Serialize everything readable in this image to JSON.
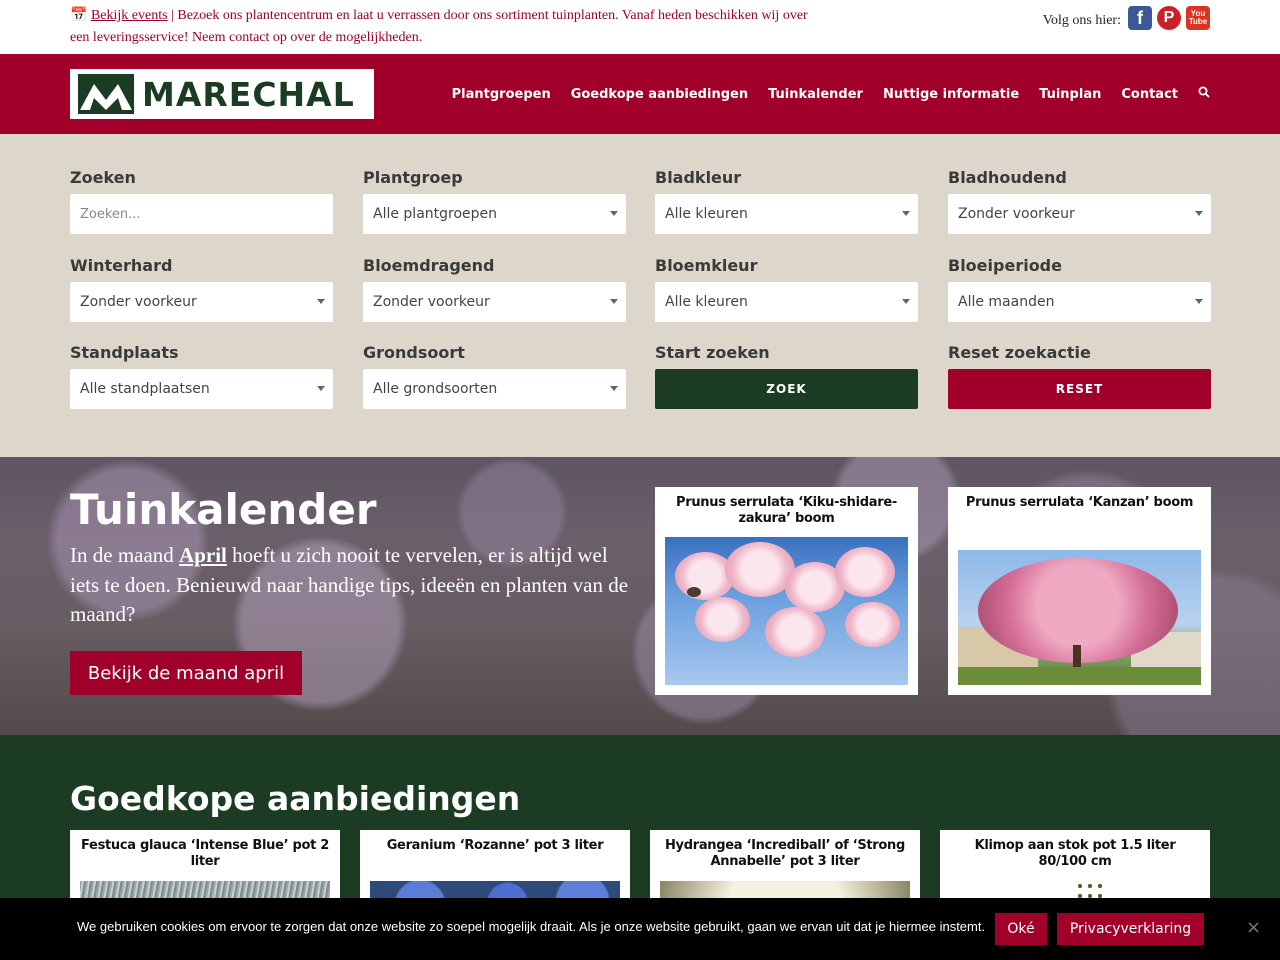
{
  "topbar": {
    "events_link": "Bekijk events",
    "separator": "|",
    "message": "Bezoek ons plantencentrum en laat u verrassen door ons sortiment tuinplanten. Vanaf heden beschikken wij over een leveringsservice! Neem contact op over de mogelijkheden.",
    "follow_label": "Volg ons hier:",
    "social": [
      "facebook-icon",
      "pinterest-icon",
      "youtube-icon"
    ]
  },
  "brand": {
    "name": "MARECHAL"
  },
  "nav": {
    "items": [
      "Plantgroepen",
      "Goedkope aanbiedingen",
      "Tuinkalender",
      "Nuttige informatie",
      "Tuinplan",
      "Contact"
    ],
    "search_icon": "search-icon"
  },
  "search": {
    "fields": [
      {
        "label": "Zoeken",
        "placeholder": "Zoeken..."
      },
      {
        "label": "Plantgroep",
        "value": "Alle plantgroepen"
      },
      {
        "label": "Bladkleur",
        "value": "Alle kleuren"
      },
      {
        "label": "Bladhoudend",
        "value": "Zonder voorkeur"
      },
      {
        "label": "Winterhard",
        "value": "Zonder voorkeur"
      },
      {
        "label": "Bloemdragend",
        "value": "Zonder voorkeur"
      },
      {
        "label": "Bloemkleur",
        "value": "Alle kleuren"
      },
      {
        "label": "Bloeiperiode",
        "value": "Alle maanden"
      },
      {
        "label": "Standplaats",
        "value": "Alle standplaatsen"
      },
      {
        "label": "Grondsoort",
        "value": "Alle grondsoorten"
      }
    ],
    "start_label": "Start zoeken",
    "zoek_button": "ZOEK",
    "reset_label": "Reset zoekactie",
    "reset_button": "RESET"
  },
  "calendar": {
    "title": "Tuinkalender",
    "text_before": "In de maand ",
    "month": "April",
    "text_after": " hoeft u zich nooit te vervelen, er is altijd wel iets te doen. Benieuwd naar handige tips, ideeën en planten van de maand?",
    "cta": "Bekijk de maand april",
    "cards": [
      {
        "title": "Prunus serrulata ‘Kiku-shidare-zakura’ boom"
      },
      {
        "title": "Prunus serrulata ‘Kanzan’ boom"
      }
    ]
  },
  "offers": {
    "title": "Goedkope aanbiedingen",
    "cards": [
      {
        "title": "Festuca glauca ‘Intense Blue’ pot 2 liter"
      },
      {
        "title": "Geranium ‘Rozanne’ pot 3 liter"
      },
      {
        "title": "Hydrangea ‘Incrediball’ of ‘Strong Annabelle’ pot 3 liter"
      },
      {
        "title": "Klimop aan stok pot 1.5 liter 80/100 cm"
      }
    ]
  },
  "cookie": {
    "text": "We gebruiken cookies om ervoor te zorgen dat onze website zo soepel mogelijk draait. Als je onze website gebruikt, gaan we ervan uit dat je hiermee instemt.",
    "ok": "Oké",
    "privacy": "Privacyverklaring",
    "close": "×"
  },
  "colors": {
    "brand_red": "#a0002a",
    "brand_green": "#1b3b22",
    "panel_beige": "#dcd6cb"
  }
}
